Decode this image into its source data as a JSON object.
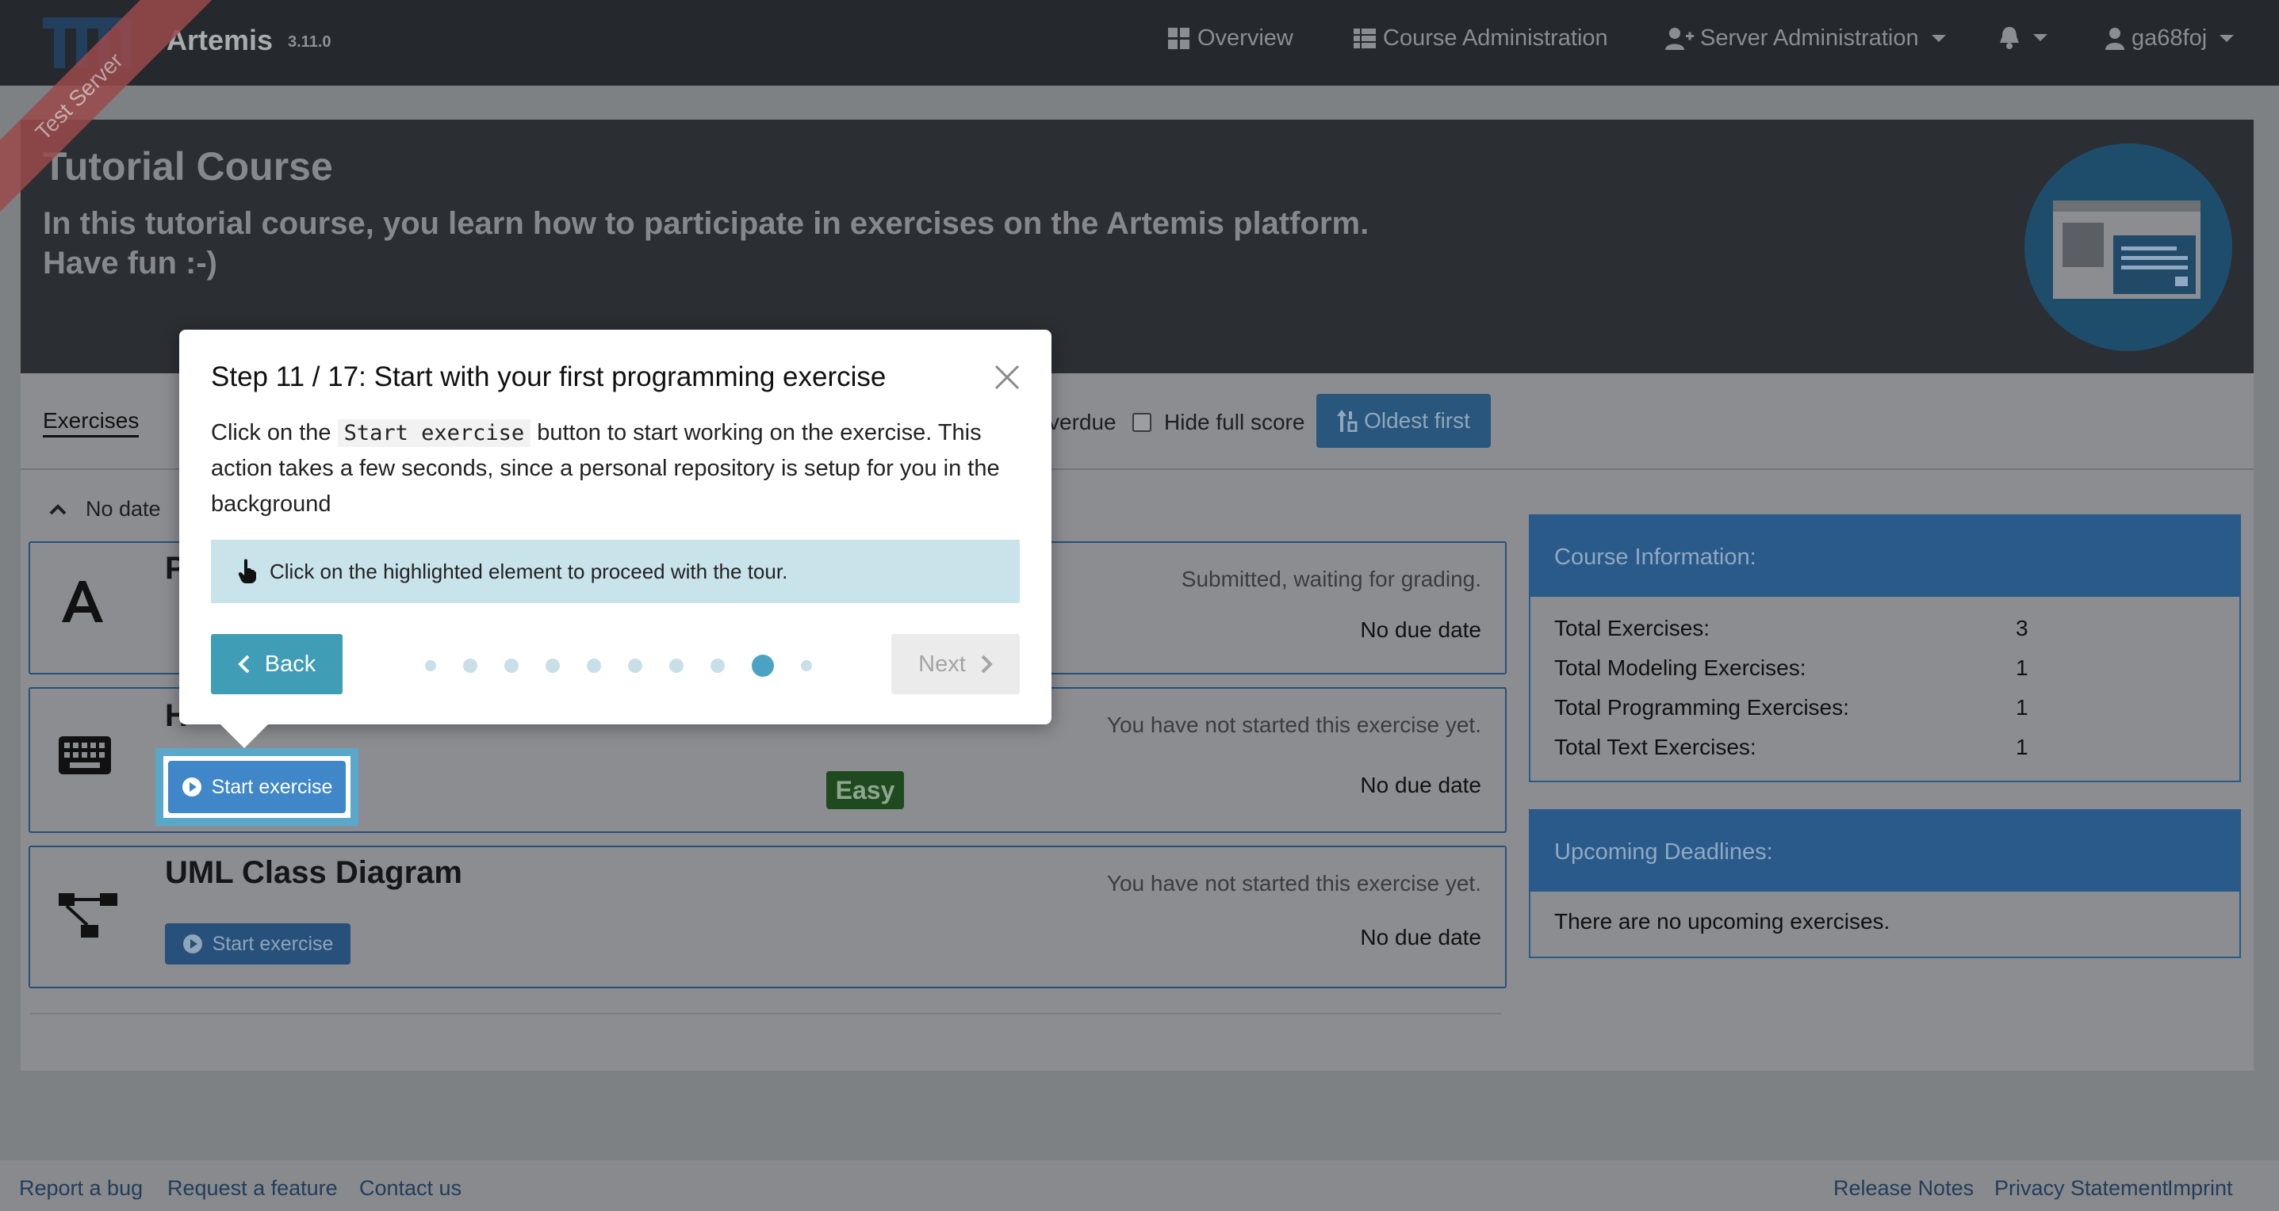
{
  "navbar": {
    "brand": "Artemis",
    "version": "3.11.0",
    "ribbon": "Test Server",
    "items": {
      "overview": "Overview",
      "course_admin": "Course Administration",
      "server_admin": "Server Administration",
      "user": "ga68foj"
    }
  },
  "course": {
    "title": "Tutorial Course",
    "description_line1": "In this tutorial course, you learn how to participate in exercises on the Artemis platform.",
    "description_line2": "Have fun :-)"
  },
  "tabs": {
    "exercises": "Exercises",
    "overdue": "verdue",
    "hide_full_score": "Hide full score",
    "sort": "Oldest first"
  },
  "group": {
    "label": "No date"
  },
  "exercises": [
    {
      "title": "P",
      "status": "Submitted, waiting for grading.",
      "due": "No due date",
      "icon": "font-icon"
    },
    {
      "title": "H",
      "status": "You have not started this exercise yet.",
      "due": "No due date",
      "icon": "keyboard-icon",
      "button": "Start exercise",
      "difficulty": "Easy"
    },
    {
      "title": "UML Class Diagram",
      "status": "You have not started this exercise yet.",
      "due": "No due date",
      "icon": "project-diagram-icon",
      "button": "Start exercise"
    }
  ],
  "course_info": {
    "heading": "Course Information:",
    "rows": [
      {
        "label": "Total Exercises:",
        "value": "3"
      },
      {
        "label": "Total Modeling Exercises:",
        "value": "1"
      },
      {
        "label": "Total Programming Exercises:",
        "value": "1"
      },
      {
        "label": "Total Text Exercises:",
        "value": "1"
      }
    ]
  },
  "deadlines": {
    "heading": "Upcoming Deadlines:",
    "empty": "There are no upcoming exercises."
  },
  "tour": {
    "title": "Step 11 / 17: Start with your first programming exercise",
    "body_pre": "Click on the ",
    "body_code": "Start exercise",
    "body_post": " button to start working on the exercise. This action takes a few seconds, since a personal repository is setup for you in the background",
    "hint": "Click on the highlighted element to proceed with the tour.",
    "back": "Back",
    "next": "Next",
    "active_step_dot": 9,
    "visible_dots": 10
  },
  "footer": {
    "report_bug": "Report a bug",
    "request_feature": "Request a feature",
    "contact": "Contact us",
    "release_notes": "Release Notes",
    "privacy": "Privacy Statement",
    "imprint": "Imprint"
  },
  "colors": {
    "navbar_bg": "#25282c",
    "primary": "#3f87c9",
    "tour_accent": "#3f9db5",
    "success": "#2e7d32"
  }
}
